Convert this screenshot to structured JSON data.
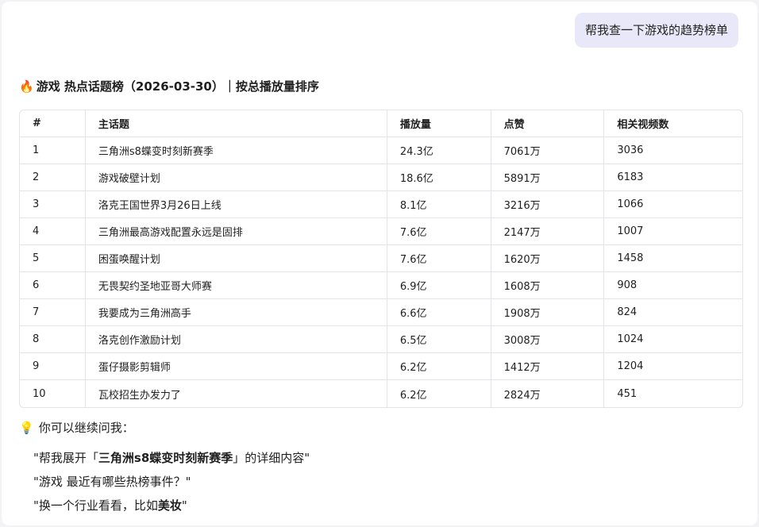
{
  "user_message": "帮我查一下游戏的趋势榜单",
  "heading": {
    "icon": "fire",
    "text": "游戏 热点话题榜（2026-03-30）｜按总播放量排序"
  },
  "table": {
    "headers": [
      "#",
      "主话题",
      "播放量",
      "点赞",
      "相关视频数"
    ],
    "rows": [
      [
        "1",
        "三角洲s8蝶变时刻新赛季",
        "24.3亿",
        "7061万",
        "3036"
      ],
      [
        "2",
        "游戏破壁计划",
        "18.6亿",
        "5891万",
        "6183"
      ],
      [
        "3",
        "洛克王国世界3月26日上线",
        "8.1亿",
        "3216万",
        "1066"
      ],
      [
        "4",
        "三角洲最高游戏配置永远是固排",
        "7.6亿",
        "2147万",
        "1007"
      ],
      [
        "5",
        "困蛋唤醒计划",
        "7.6亿",
        "1620万",
        "1458"
      ],
      [
        "6",
        "无畏契约圣地亚哥大师赛",
        "6.9亿",
        "1608万",
        "908"
      ],
      [
        "7",
        "我要成为三角洲高手",
        "6.6亿",
        "1908万",
        "824"
      ],
      [
        "8",
        "洛克创作激励计划",
        "6.5亿",
        "3008万",
        "1024"
      ],
      [
        "9",
        "蛋仔摄影剪辑师",
        "6.2亿",
        "1412万",
        "1204"
      ],
      [
        "10",
        "瓦校招生办发力了",
        "6.2亿",
        "2824万",
        "451"
      ]
    ]
  },
  "suggestions": {
    "icon": "lightbulb",
    "title": "你可以继续问我：",
    "items": [
      {
        "pre": "\"帮我展开「",
        "bold": "三角洲s8蝶变时刻新赛季",
        "post": "」的详细内容\""
      },
      {
        "pre": "\"游戏 最近有哪些热榜事件？\"",
        "bold": "",
        "post": ""
      },
      {
        "pre": "\"换一个行业看看，比如",
        "bold": "美妆",
        "post": "\""
      }
    ]
  }
}
